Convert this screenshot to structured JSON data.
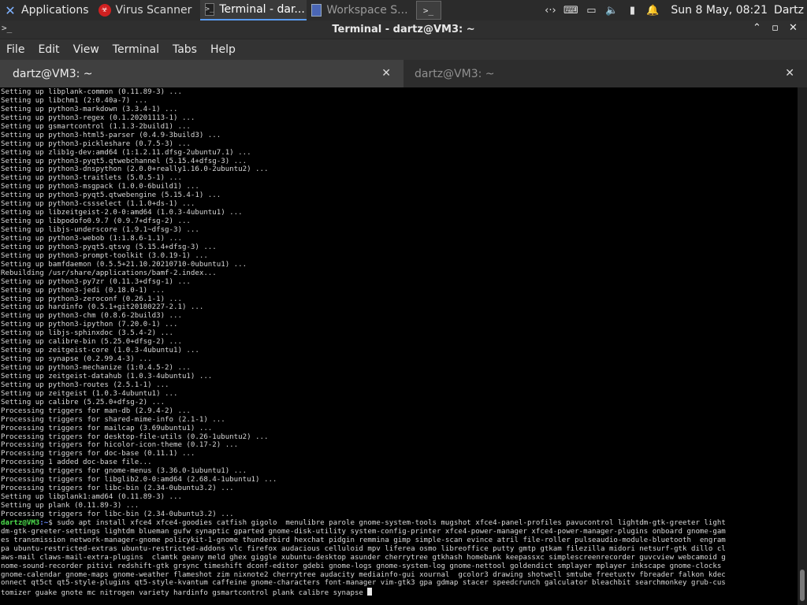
{
  "panel": {
    "applications_label": "Applications",
    "tasks": [
      {
        "label": "Virus Scanner",
        "icon": "virus-scanner-icon"
      },
      {
        "label": "Terminal - dar...",
        "icon": "terminal-icon"
      },
      {
        "label": "Workspace S...",
        "icon": "workspace-icon"
      }
    ],
    "clock": "Sun  8 May, 08:21",
    "user": "Dartz"
  },
  "window": {
    "title": "Terminal - dartz@VM3: ~"
  },
  "menu": [
    "File",
    "Edit",
    "View",
    "Terminal",
    "Tabs",
    "Help"
  ],
  "tabs": [
    {
      "label": "dartz@VM3: ~"
    },
    {
      "label": "dartz@VM3: ~"
    }
  ],
  "terminal": {
    "lines": [
      "Setting up libplank-common (0.11.89-3) ...",
      "Setting up libchm1 (2:0.40a-7) ...",
      "Setting up python3-markdown (3.3.4-1) ...",
      "Setting up python3-regex (0.1.20201113-1) ...",
      "Setting up gsmartcontrol (1.1.3-2build1) ...",
      "Setting up python3-html5-parser (0.4.9-3build3) ...",
      "Setting up python3-pickleshare (0.7.5-3) ...",
      "Setting up zlib1g-dev:amd64 (1:1.2.11.dfsg-2ubuntu7.1) ...",
      "Setting up python3-pyqt5.qtwebchannel (5.15.4+dfsg-3) ...",
      "Setting up python3-dnspython (2.0.0+really1.16.0-2ubuntu2) ...",
      "Setting up python3-traitlets (5.0.5-1) ...",
      "Setting up python3-msgpack (1.0.0-6build1) ...",
      "Setting up python3-pyqt5.qtwebengine (5.15.4-1) ...",
      "Setting up python3-cssselect (1.1.0+ds-1) ...",
      "Setting up libzeitgeist-2.0-0:amd64 (1.0.3-4ubuntu1) ...",
      "Setting up libpodofo0.9.7 (0.9.7+dfsg-2) ...",
      "Setting up libjs-underscore (1.9.1~dfsg-3) ...",
      "Setting up python3-webob (1:1.8.6-1.1) ...",
      "Setting up python3-pyqt5.qtsvg (5.15.4+dfsg-3) ...",
      "Setting up python3-prompt-toolkit (3.0.19-1) ...",
      "Setting up bamfdaemon (0.5.5+21.10.20210710-0ubuntu1) ...",
      "Rebuilding /usr/share/applications/bamf-2.index...",
      "Setting up python3-py7zr (0.11.3+dfsg-1) ...",
      "Setting up python3-jedi (0.18.0-1) ...",
      "Setting up python3-zeroconf (0.26.1-1) ...",
      "Setting up hardinfo (0.5.1+git20180227-2.1) ...",
      "Setting up python3-chm (0.8.6-2build3) ...",
      "Setting up python3-ipython (7.20.0-1) ...",
      "Setting up libjs-sphinxdoc (3.5.4-2) ...",
      "Setting up calibre-bin (5.25.0+dfsg-2) ...",
      "Setting up zeitgeist-core (1.0.3-4ubuntu1) ...",
      "Setting up synapse (0.2.99.4-3) ...",
      "Setting up python3-mechanize (1:0.4.5-2) ...",
      "Setting up zeitgeist-datahub (1.0.3-4ubuntu1) ...",
      "Setting up python3-routes (2.5.1-1) ...",
      "Setting up zeitgeist (1.0.3-4ubuntu1) ...",
      "Setting up calibre (5.25.0+dfsg-2) ...",
      "Processing triggers for man-db (2.9.4-2) ...",
      "Processing triggers for shared-mime-info (2.1-1) ...",
      "Processing triggers for mailcap (3.69ubuntu1) ...",
      "Processing triggers for desktop-file-utils (0.26-1ubuntu2) ...",
      "Processing triggers for hicolor-icon-theme (0.17-2) ...",
      "Processing triggers for doc-base (0.11.1) ...",
      "Processing 1 added doc-base file...",
      "Processing triggers for gnome-menus (3.36.0-1ubuntu1) ...",
      "Processing triggers for libglib2.0-0:amd64 (2.68.4-1ubuntu1) ...",
      "Processing triggers for libc-bin (2.34-0ubuntu3.2) ...",
      "Setting up libplank1:amd64 (0.11.89-3) ...",
      "Setting up plank (0.11.89-3) ...",
      "Processing triggers for libc-bin (2.34-0ubuntu3.2) ..."
    ],
    "prompt_user": "dartz@VM3",
    "prompt_path": ":~",
    "prompt_symbol": "$",
    "command_lines": [
      " sudo apt install xfce4 xfce4-goodies catfish gigolo  menulibre parole gnome-system-tools mugshot xfce4-panel-profiles pavucontrol lightdm-gtk-greeter light",
      "dm-gtk-greeter-settings lightdm blueman gufw synaptic gparted gnome-disk-utility system-config-printer xfce4-power-manager xfce4-power-manager-plugins onboard gnome-gam",
      "es transmission network-manager-gnome policykit-1-gnome thunderbird hexchat pidgin remmina gimp simple-scan evince atril file-roller pulseaudio-module-bluetooth  engram",
      "pa ubuntu-restricted-extras ubuntu-restricted-addons vlc firefox audacious celluloid mpv liferea osmo libreoffice putty gmtp gtkam filezilla midori netsurf-gtk dillo cl",
      "aws-mail claws-mail-extra-plugins  clamtk geany meld ghex giggle xubuntu-desktop asunder cherrytree gtkhash homebank keepassxc simplescreenrecorder guvcview webcamoid g",
      "nome-sound-recorder pitivi redshift-gtk grsync timeshift dconf-editor gdebi gnome-logs gnome-system-log gnome-nettool goldendict smplayer mplayer inkscape gnome-clocks",
      "gnome-calendar gnome-maps gnome-weather flameshot zim nixnote2 cherrytree audacity mediainfo-gui xournal  gcolor3 drawing shotwell smtube freetuxtv fbreader falkon kdec",
      "onnect qt5ct qt5-style-plugins qt5-style-kvantum caffeine gnome-characters font-manager vim-gtk3 gpa gdmap stacer speedcrunch galculator bleachbit searchmonkey grub-cus",
      "tomizer guake gnote mc nitrogen variety hardinfo gsmartcontrol plank calibre synapse "
    ]
  }
}
